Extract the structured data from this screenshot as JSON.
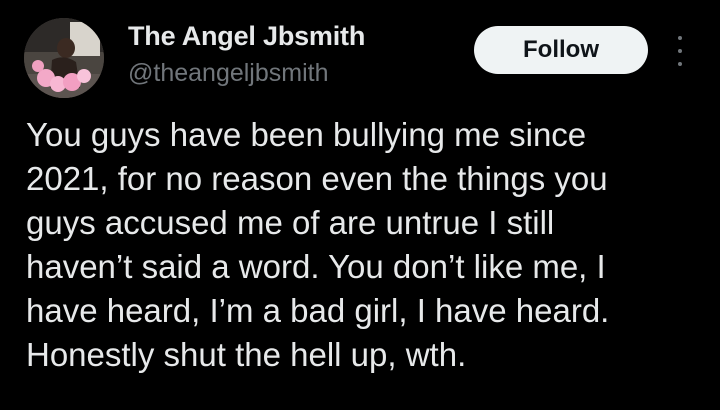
{
  "author": {
    "display_name": "The Angel Jbsmith",
    "handle": "@theangeljbsmith",
    "avatar_icon": "profile-photo"
  },
  "actions": {
    "follow_label": "Follow",
    "more_icon": "more-options-icon"
  },
  "tweet": {
    "lines": [
      "You guys have been bullying me since",
      "2021, for no reason even the things you",
      "guys accused me of are untrue I still",
      "haven’t said a word. You don’t like me, I",
      "have heard, I’m a bad girl, I have heard.",
      "Honestly shut the hell up, wth."
    ]
  },
  "colors": {
    "background": "#000000",
    "primary_text": "#e7e9ea",
    "secondary_text": "#71767b",
    "follow_bg": "#eff3f4",
    "follow_text": "#0f1419"
  }
}
